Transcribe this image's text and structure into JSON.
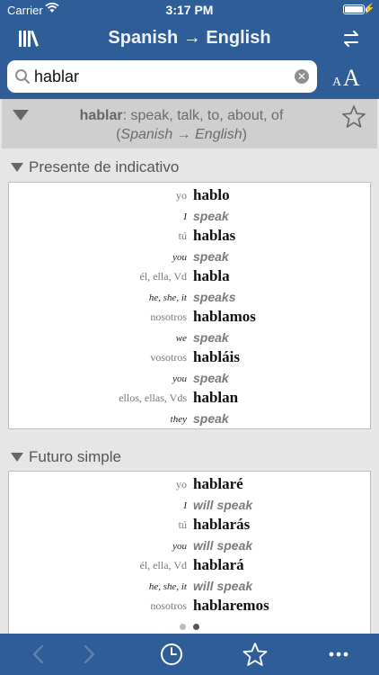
{
  "status_bar": {
    "carrier": "Carrier",
    "time": "3:17 PM"
  },
  "nav": {
    "title": "Spanish → English"
  },
  "search": {
    "query": "hablar",
    "font_small": "A",
    "font_big": "A"
  },
  "entry": {
    "headword": "hablar",
    "separator": ":",
    "translations": " speak, talk, to, about, of",
    "direction_open": "(",
    "direction": "Spanish → English",
    "direction_close": ")"
  },
  "sections": [
    {
      "title": "Presente de indicativo",
      "rows": [
        {
          "pronoun": "yo",
          "verb": "hablo",
          "en_pronoun": "I",
          "translation": "speak"
        },
        {
          "pronoun": "tú",
          "verb": "hablas",
          "en_pronoun": "you",
          "translation": "speak"
        },
        {
          "pronoun": "él, ella, Vd",
          "verb": "habla",
          "en_pronoun": "he, she, it",
          "translation": "speaks"
        },
        {
          "pronoun": "nosotros",
          "verb": "hablamos",
          "en_pronoun": "we",
          "translation": "speak"
        },
        {
          "pronoun": "vosotros",
          "verb": "habláis",
          "en_pronoun": "you",
          "translation": "speak"
        },
        {
          "pronoun": "ellos, ellas, Vds",
          "verb": "hablan",
          "en_pronoun": "they",
          "translation": "speak"
        }
      ]
    },
    {
      "title": "Futuro simple",
      "rows": [
        {
          "pronoun": "yo",
          "verb": "hablaré",
          "en_pronoun": "I",
          "translation": "will speak"
        },
        {
          "pronoun": "tú",
          "verb": "hablarás",
          "en_pronoun": "you",
          "translation": "will speak"
        },
        {
          "pronoun": "él, ella, Vd",
          "verb": "hablará",
          "en_pronoun": "he, she, it",
          "translation": "will speak"
        },
        {
          "pronoun": "nosotros",
          "verb": "hablaremos",
          "en_pronoun": "",
          "translation": ""
        }
      ]
    }
  ],
  "page_control": {
    "current": 2,
    "total": 2
  },
  "colors": {
    "brand": "#2f5d97",
    "background": "#e6e6e6",
    "header": "#cfcfcf"
  },
  "icons": [
    "library-icon",
    "swap-languages-icon",
    "search-icon",
    "clear-icon",
    "star-icon",
    "back-arrow-icon",
    "forward-arrow-icon",
    "history-clock-icon",
    "favorites-star-icon",
    "more-icon"
  ]
}
